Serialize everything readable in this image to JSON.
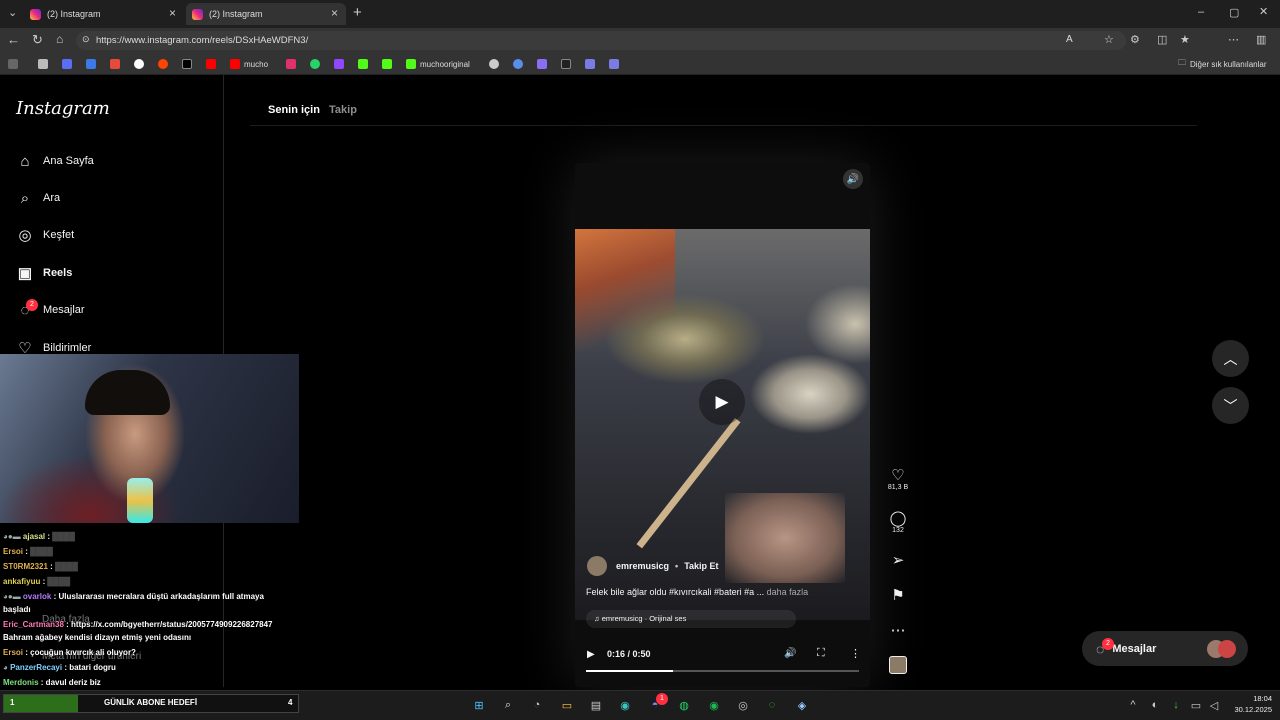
{
  "browser": {
    "tabs": [
      {
        "title": "(2) Instagram"
      },
      {
        "title": "(2) Instagram"
      }
    ],
    "url": "https://www.instagram.com/reels/DSxHAeWDFN3/",
    "bookmarks": [
      "mucho",
      "muchooriginal"
    ],
    "other_bookmarks": "Diğer sık kullanılanlar"
  },
  "sidebar": {
    "logo": "Instagram",
    "items": [
      {
        "label": "Ana Sayfa",
        "icon": "home-icon"
      },
      {
        "label": "Ara",
        "icon": "search-icon"
      },
      {
        "label": "Keşfet",
        "icon": "compass-icon"
      },
      {
        "label": "Reels",
        "icon": "reels-icon"
      },
      {
        "label": "Mesajlar",
        "icon": "messenger-icon",
        "badge": "2"
      },
      {
        "label": "Bildirimler",
        "icon": "heart-icon"
      }
    ],
    "more": "Daha fazla",
    "meta": "Meta'nın diğer ürünleri"
  },
  "feed": {
    "tab_active": "Senin için",
    "tab_other": "Takip"
  },
  "reel": {
    "author": "emremusicg",
    "follow": "Takip Et",
    "caption": "Felek bile ağlar oldu #kıvırcıkali #bateri #a ...",
    "caption_more": "daha fazla",
    "audio": "emremusicg · Orijinal ses",
    "time": "0:16 / 0:50",
    "progress": 0.32
  },
  "actions": {
    "likes": "81,3 B",
    "comments": "132"
  },
  "messages": {
    "label": "Mesajlar",
    "badge": "2"
  },
  "stream": {
    "chat": [
      {
        "user": "ajasal",
        "text": ":"
      },
      {
        "user": "Ersoi",
        "text": ":"
      },
      {
        "user": "ST0RM2321",
        "text": ":"
      },
      {
        "user": "ankafiyuu",
        "text": ":"
      },
      {
        "user": "ovarlok",
        "text": ": Uluslararası mecralara düştü arkadaşlarım full atmaya"
      },
      {
        "user": "",
        "text": "başladı"
      },
      {
        "user": "Eric_Cartman38",
        "text": ": https://x.com/bgyetherr/status/2005774909226827847"
      },
      {
        "user": "",
        "text": "Bahram ağabey kendisi dizayn etmiş yeni odasını"
      },
      {
        "user": "Ersoi",
        "text": ": çocuğun kıvırcık ali oluyor?"
      },
      {
        "user": "PanzerRecayi",
        "text": ": batari dogru"
      },
      {
        "user": "Merdonis",
        "text": ": davul deriz biz"
      }
    ],
    "goal_num": "1",
    "goal_label": "GÜNLİK ABONE HEDEFİ",
    "goal_target": "4",
    "goal_fraction": 0.25
  },
  "taskbar": {
    "time": "18:04",
    "date": "30.12.2025",
    "badge": "1"
  },
  "colors": {
    "accent": "#0095f6",
    "badge": "#ff3040",
    "goal_fill": "#2d6e1a"
  }
}
